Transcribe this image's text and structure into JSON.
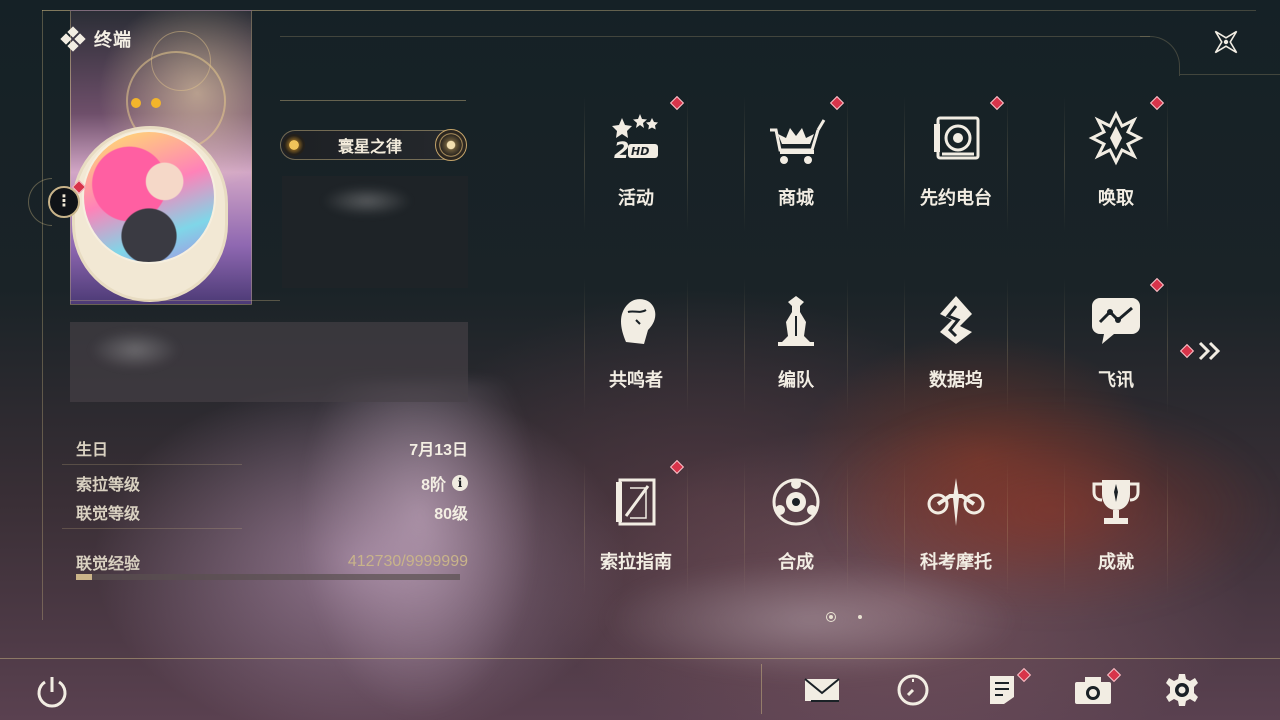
{
  "header": {
    "title": "终端",
    "title_icon": "diamond-cluster-icon",
    "close_icon": "close-star-icon"
  },
  "profile": {
    "name": "寰星之律",
    "stats": [
      {
        "label": "生日",
        "value": "7月13日"
      },
      {
        "label": "索拉等级",
        "value": "8阶",
        "info": "i"
      },
      {
        "label": "联觉等级",
        "value": "80级"
      }
    ],
    "exp": {
      "label": "联觉经验",
      "value": "412730/9999999",
      "progress": 0.041
    }
  },
  "menu": {
    "items": [
      {
        "label": "活动",
        "icon": "event-2hd-icon",
        "badge": true
      },
      {
        "label": "商城",
        "icon": "shop-cart-icon",
        "badge": true
      },
      {
        "label": "先约电台",
        "icon": "radio-icon",
        "badge": true
      },
      {
        "label": "唤取",
        "icon": "convene-icon",
        "badge": true
      },
      {
        "label": "共鸣者",
        "icon": "resonator-icon",
        "badge": false
      },
      {
        "label": "编队",
        "icon": "team-chess-icon",
        "badge": false
      },
      {
        "label": "数据坞",
        "icon": "data-bank-icon",
        "badge": false
      },
      {
        "label": "飞讯",
        "icon": "chat-icon",
        "badge": true
      },
      {
        "label": "索拉指南",
        "icon": "guidebook-icon",
        "badge": true
      },
      {
        "label": "合成",
        "icon": "synthesis-icon",
        "badge": false
      },
      {
        "label": "科考摩托",
        "icon": "motorcycle-icon",
        "badge": false
      },
      {
        "label": "成就",
        "icon": "trophy-icon",
        "badge": false
      }
    ],
    "next_page_icon": "double-chevron-right-icon",
    "pager": {
      "current": 1,
      "total": 2
    }
  },
  "bottom_bar": {
    "left": [
      {
        "icon": "power-icon"
      }
    ],
    "right": [
      {
        "icon": "mail-icon",
        "badge": false
      },
      {
        "icon": "clock-icon",
        "badge": false
      },
      {
        "icon": "notes-icon",
        "badge": true
      },
      {
        "icon": "camera-icon",
        "badge": true
      },
      {
        "icon": "settings-gear-icon",
        "badge": false
      }
    ]
  },
  "colors": {
    "accent_gold": "#c9b48a",
    "badge_red": "#d8344a",
    "text_light": "#f2ede3"
  }
}
